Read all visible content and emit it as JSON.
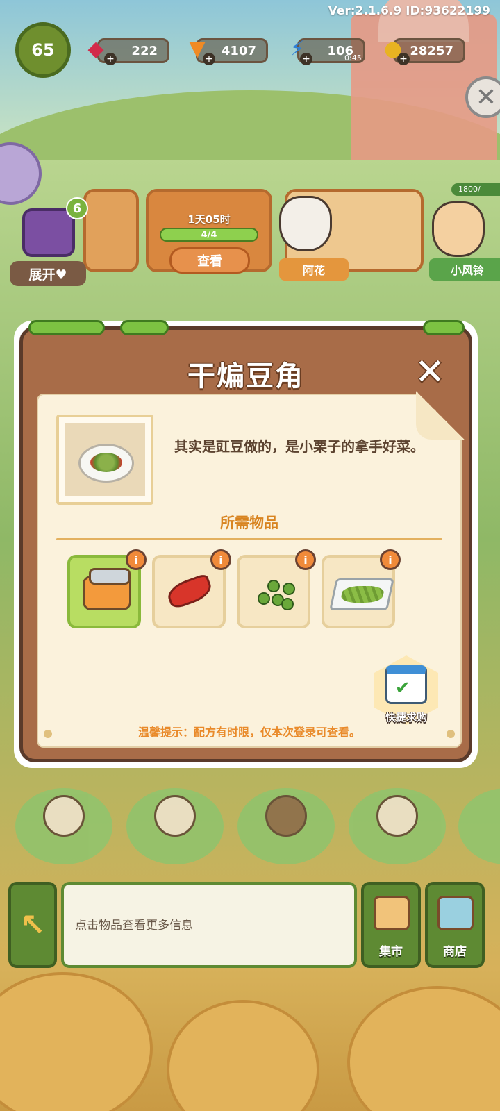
{
  "hud": {
    "version": "Ver:2.1.6.9 ID:93622199",
    "level": "65",
    "gems": "222",
    "carrots": "4107",
    "energy": "106",
    "energy_timer": "0:45",
    "coins": "28257",
    "plus": "+"
  },
  "top_area": {
    "chest_badge": "6",
    "expand_button": "展开♥",
    "order_timer": "1天05时",
    "order_progress": "4/4",
    "view_button": "查看",
    "npc_1_name": "阿花",
    "npc_2_name": "小风铃",
    "npc_2_bar": "1800/",
    "close_icon": "✕"
  },
  "dialog": {
    "title": "干煸豆角",
    "close": "✕",
    "description": "其实是豇豆做的，是小栗子的拿手好菜。",
    "required_items_label": "所需物品",
    "items": [
      {
        "name": "pot-icon",
        "info": "i",
        "selected": true
      },
      {
        "name": "chili-icon",
        "info": "i",
        "selected": false
      },
      {
        "name": "sichuan-pepper-icon",
        "info": "i",
        "selected": false
      },
      {
        "name": "green-beans-tray-icon",
        "info": "i",
        "selected": false
      }
    ],
    "quick_buy_label": "快捷求购",
    "tip": "温馨提示：配方有时限，仅本次登录可查看。"
  },
  "bottom_bar": {
    "back_icon": "↖",
    "info_text": "点击物品查看更多信息",
    "market_label": "集市",
    "shop_label": "商店"
  },
  "colors": {
    "dialog_frame": "#a86c48",
    "paper": "#fbf2dc",
    "accent_orange": "#d88420",
    "selected_item": "#b8dd62",
    "grass": "#7cc242"
  }
}
